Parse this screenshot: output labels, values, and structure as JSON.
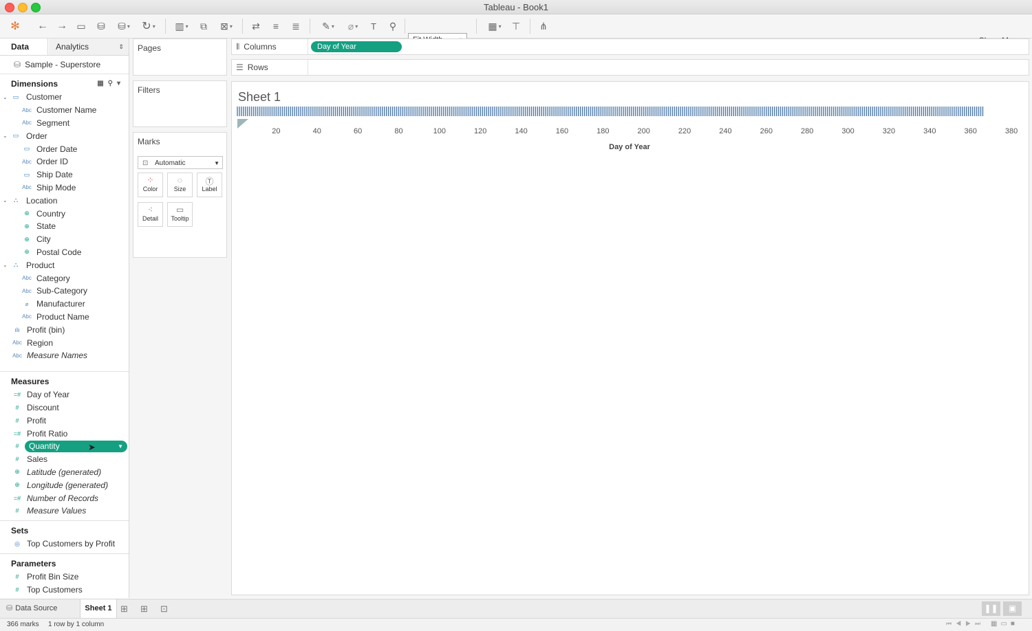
{
  "window": {
    "title": "Tableau - Book1"
  },
  "toolbar": {
    "fit": "Fit Width",
    "show_me": "Show Me"
  },
  "pane_tabs": {
    "data": "Data",
    "analytics": "Analytics"
  },
  "datasource": "Sample - Superstore",
  "dimensions": {
    "header": "Dimensions",
    "groups": [
      {
        "name": "Customer",
        "fields": [
          "Customer Name",
          "Segment"
        ]
      },
      {
        "name": "Order",
        "fields": [
          "Order Date",
          "Order ID",
          "Ship Date",
          "Ship Mode"
        ]
      },
      {
        "name": "Location",
        "fields": [
          "Country",
          "State",
          "City",
          "Postal Code"
        ]
      },
      {
        "name": "Product",
        "fields": [
          "Category",
          "Sub-Category",
          "Manufacturer",
          "Product Name"
        ]
      }
    ],
    "loose": [
      "Profit (bin)",
      "Region",
      "Measure Names"
    ]
  },
  "measures": {
    "header": "Measures",
    "fields": [
      "Day of Year",
      "Discount",
      "Profit",
      "Profit Ratio",
      "Quantity",
      "Sales",
      "Latitude (generated)",
      "Longitude (generated)",
      "Number of Records",
      "Measure Values"
    ]
  },
  "sets": {
    "header": "Sets",
    "fields": [
      "Top Customers by Profit"
    ]
  },
  "parameters": {
    "header": "Parameters",
    "fields": [
      "Profit Bin Size",
      "Top Customers"
    ]
  },
  "cards": {
    "pages": "Pages",
    "filters": "Filters",
    "marks": "Marks",
    "mark_type": "Automatic",
    "mark_buttons": [
      "Color",
      "Size",
      "Label",
      "Detail",
      "Tooltip"
    ]
  },
  "shelves": {
    "columns": "Columns",
    "rows": "Rows",
    "columns_pill": "Day of Year"
  },
  "sheet": {
    "title": "Sheet 1"
  },
  "chart_data": {
    "type": "strip",
    "xlabel": "Day of Year",
    "x_ticks": [
      20,
      40,
      60,
      80,
      100,
      120,
      140,
      160,
      180,
      200,
      220,
      240,
      260,
      280,
      300,
      320,
      340,
      360,
      380
    ],
    "xlim": [
      1,
      381
    ],
    "mark_count": 366,
    "x_range_of_marks": [
      1,
      366
    ],
    "mark_color": "#4e79a7"
  },
  "bottom_tabs": {
    "data_source": "Data Source",
    "sheet1": "Sheet 1"
  },
  "status": {
    "marks": "366 marks",
    "dims": "1 row by 1 column"
  },
  "colors": {
    "pill": "#15a082",
    "dimension_icon": "#2f78c1",
    "measure_icon": "#17a38a"
  }
}
